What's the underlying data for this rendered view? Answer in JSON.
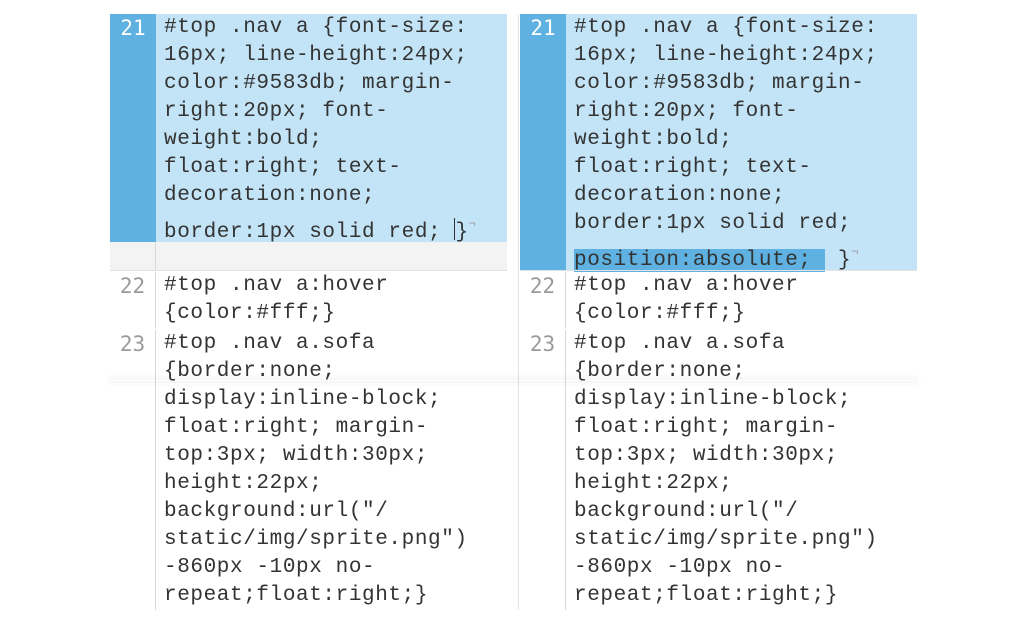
{
  "left": {
    "line21": {
      "number": "21",
      "lines": [
        "#top .nav a {font-size:",
        "16px; line-height:24px;",
        "color:#9583db; margin-",
        "right:20px; font-",
        "weight:bold;",
        "float:right; text-",
        "decoration:none;",
        "border:1px solid red; "
      ],
      "close": "}"
    },
    "line22": {
      "number": "22",
      "lines": [
        "#top .nav a:hover",
        "{color:#fff;}"
      ]
    },
    "line23": {
      "number": "23",
      "lines": [
        "#top .nav a.sofa",
        "{border:none;",
        "display:inline-block;",
        "float:right; margin-",
        "top:3px; width:30px;",
        "height:22px;",
        "background:url(\"/",
        "static/img/sprite.png\")",
        "-860px -10px no-",
        "repeat;float:right;}"
      ]
    }
  },
  "right": {
    "line21": {
      "number": "21",
      "lines": [
        "#top .nav a {font-size:",
        "16px; line-height:24px;",
        "color:#9583db; margin-",
        "right:20px; font-",
        "weight:bold;",
        "float:right; text-",
        "decoration:none;",
        "border:1px solid red;"
      ],
      "added": "position:absolute; ",
      "close": "}"
    },
    "line22": {
      "number": "22",
      "lines": [
        "#top .nav a:hover",
        "{color:#fff;}"
      ]
    },
    "line23": {
      "number": "23",
      "lines": [
        "#top .nav a.sofa",
        "{border:none;",
        "display:inline-block;",
        "float:right; margin-",
        "top:3px; width:30px;",
        "height:22px;",
        "background:url(\"/",
        "static/img/sprite.png\")",
        "-860px -10px no-",
        "repeat;float:right;}"
      ]
    }
  }
}
